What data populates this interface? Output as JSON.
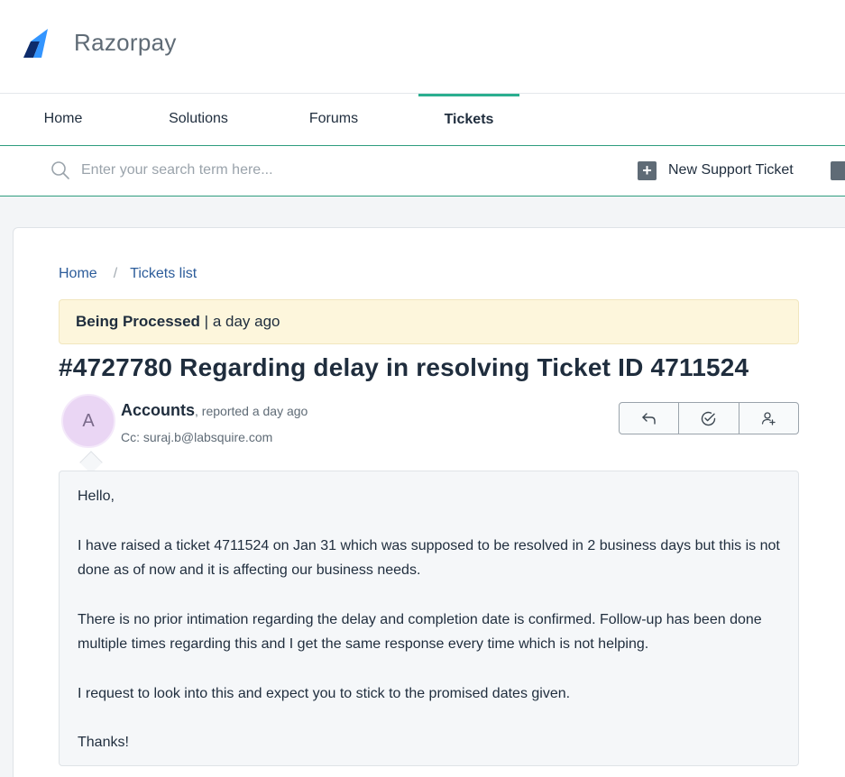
{
  "brand": {
    "name": "Razorpay",
    "logo_icon": "razorpay-logo-icon"
  },
  "nav": {
    "items": [
      {
        "label": "Home",
        "active": false
      },
      {
        "label": "Solutions",
        "active": false
      },
      {
        "label": "Forums",
        "active": false
      },
      {
        "label": "Tickets",
        "active": true
      }
    ]
  },
  "search": {
    "placeholder": "Enter your search term here...",
    "value": "",
    "icon": "search-icon"
  },
  "toolbar": {
    "new_ticket_label": "New Support Ticket",
    "new_ticket_icon": "plus-square-icon",
    "status_icon": "activity-icon"
  },
  "breadcrumb": {
    "home": "Home",
    "separator": "/",
    "current": "Tickets list"
  },
  "status": {
    "state": "Being Processed",
    "separator": " | ",
    "time": "a day ago"
  },
  "ticket": {
    "title": "#4727780 Regarding delay in resolving Ticket ID 4711524",
    "avatar_initial": "A",
    "reporter_name": "Accounts",
    "reporter_meta": ", reported a day ago",
    "cc": "Cc: suraj.b@labsquire.com"
  },
  "actions": {
    "reply_icon": "reply-icon",
    "resolve_icon": "check-circle-icon",
    "assign_icon": "add-user-icon"
  },
  "message": {
    "paragraphs": [
      "Hello,",
      "I have raised a ticket 4711524 on Jan 31 which was supposed to be resolved in 2 business days but this is not done as of now and it is affecting our business needs.",
      "There is no prior intimation regarding the delay and completion date is confirmed. Follow-up has been done multiple times regarding this and I get the same response every time which is not helping.",
      "I request to look into this and expect you to stick to the promised dates given.",
      "Thanks!"
    ]
  },
  "colors": {
    "accent": "#2bae8f",
    "link": "#2c5c9a",
    "status_bg": "#fdf6dc",
    "avatar_bg": "#ead6f4"
  }
}
